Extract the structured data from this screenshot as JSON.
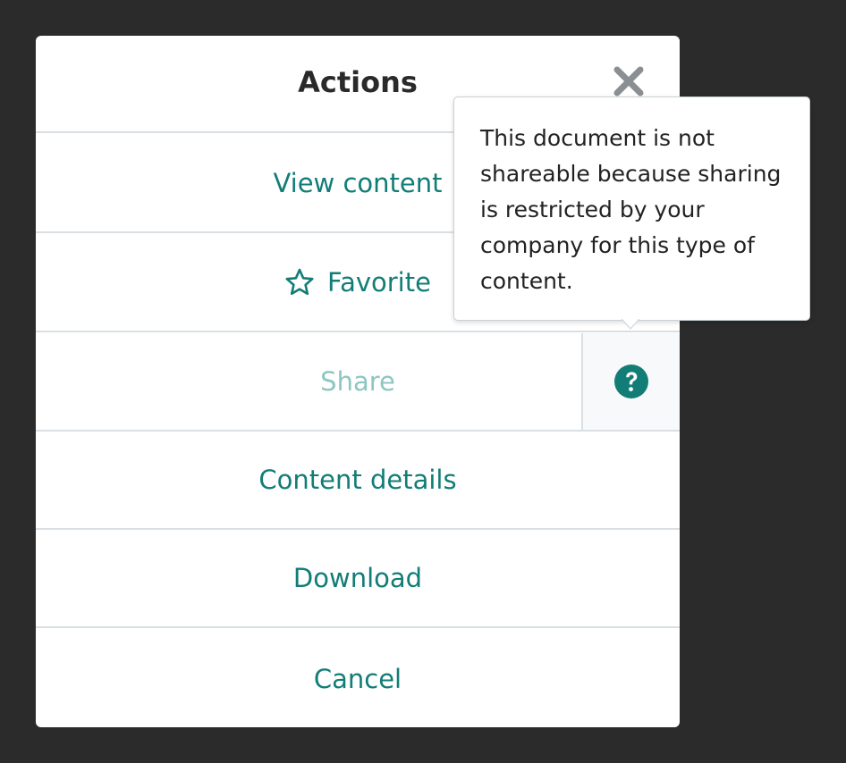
{
  "modal": {
    "title": "Actions",
    "close_icon": "close-icon"
  },
  "actions": {
    "view_content": "View content",
    "favorite": "Favorite",
    "favorite_icon": "star-icon",
    "share": "Share",
    "share_help_icon": "question-circle-icon",
    "content_details": "Content details",
    "download": "Download",
    "cancel": "Cancel"
  },
  "tooltip": {
    "text": "This document is not shareable because sharing is restricted by your company for this type of content."
  },
  "colors": {
    "accent": "#127d76",
    "disabled_text": "#8ec6c1",
    "title_text": "#2a2a2a",
    "backdrop": "#2b2b2b",
    "divider": "#d9dfe3",
    "close_icon": "#8a8f93"
  }
}
